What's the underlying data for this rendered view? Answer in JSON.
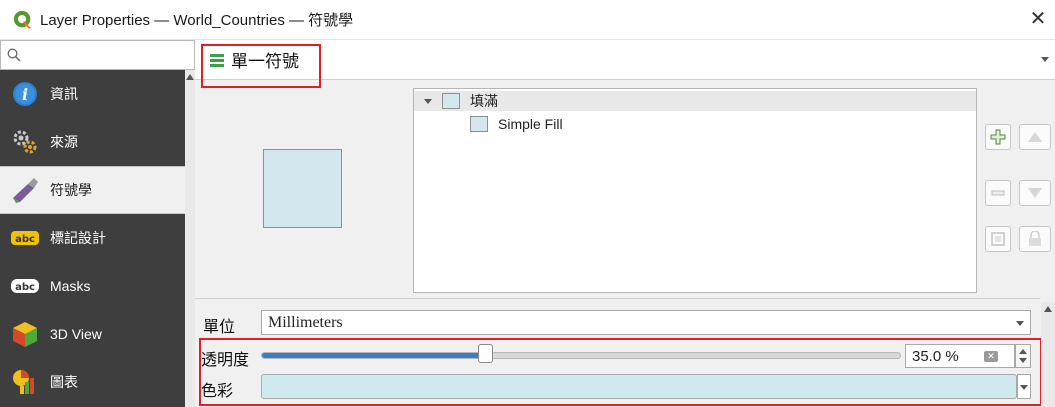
{
  "window": {
    "title": "Layer Properties — World_Countries — 符號學",
    "close_glyph": "✕"
  },
  "sidebar": {
    "search_placeholder": "",
    "items": [
      {
        "label": "資訊",
        "icon": "info-icon"
      },
      {
        "label": "來源",
        "icon": "source-icon"
      },
      {
        "label": "符號學",
        "icon": "symbology-icon",
        "active": true
      },
      {
        "label": "標記設計",
        "icon": "labels-icon"
      },
      {
        "label": "Masks",
        "icon": "masks-icon"
      },
      {
        "label": "3D View",
        "icon": "3d-view-icon"
      },
      {
        "label": "圖表",
        "icon": "diagrams-icon"
      }
    ]
  },
  "renderer": {
    "label": "單一符號"
  },
  "symbol_tree": {
    "root_label": "填滿",
    "child_label": "Simple Fill"
  },
  "properties": {
    "unit_label": "單位",
    "unit_value": "Millimeters",
    "opacity_label": "透明度",
    "opacity_value": "35.0 %",
    "opacity_level": 0.35,
    "color_label": "色彩",
    "color_value": "#cfe9ee"
  },
  "colors": {
    "highlight": "#e01f26",
    "sidebar_bg": "#3e3e3e",
    "slider_fill": "#3a7ec4",
    "fill_preview": "#d3e7ee"
  }
}
